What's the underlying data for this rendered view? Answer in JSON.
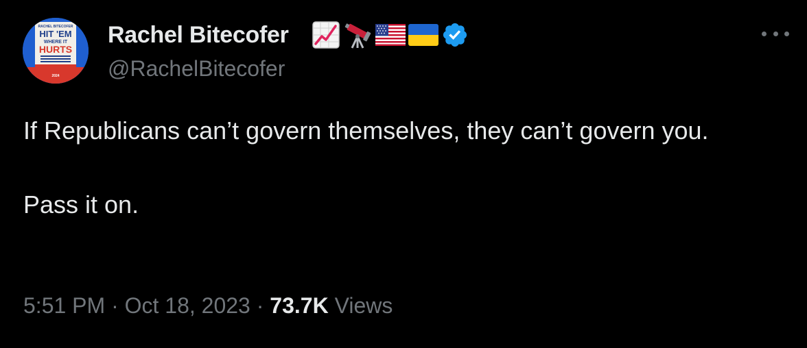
{
  "author": {
    "name": "Rachel Bitecofer",
    "handle": "@RachelBitecofer",
    "avatar_text": {
      "line1": "RACHEL BITECOFER",
      "line2": "HIT 'EM",
      "line3": "WHERE IT",
      "line4": "HURTS",
      "line5": "2024"
    },
    "badges": [
      "chart-increasing-icon",
      "telescope-icon",
      "us-flag-icon",
      "ukraine-flag-icon",
      "verified-badge-icon"
    ]
  },
  "tweet": {
    "line1": "If Republicans can’t govern themselves, they can’t govern you.",
    "line2": "Pass it on."
  },
  "meta": {
    "time": "5:51 PM",
    "sep1": " · ",
    "date": "Oct 18, 2023",
    "sep2": " · ",
    "views_count": "73.7K",
    "views_label": " Views"
  },
  "colors": {
    "background": "#000000",
    "primary_text": "#e7e9ea",
    "secondary_text": "#71767b",
    "verified": "#1d9bf0"
  }
}
